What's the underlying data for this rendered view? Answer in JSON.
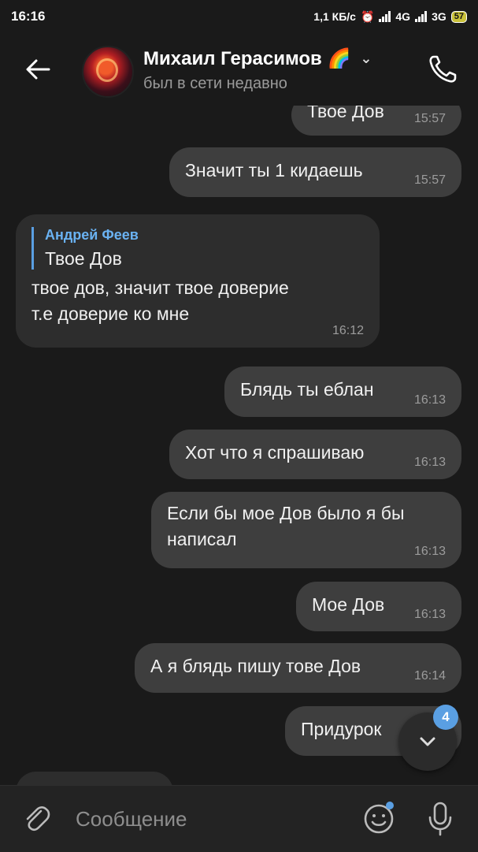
{
  "status_bar": {
    "time": "16:16",
    "speed": "1,1 КБ/с",
    "net1": "4G",
    "net2": "3G",
    "battery": "57"
  },
  "header": {
    "contact_name": "Михаил Герасимов 🌈",
    "last_seen": "был в сети недавно"
  },
  "messages": [
    {
      "text": "Твое Дов",
      "time": "15:57"
    },
    {
      "text": "Значит ты 1 кидаешь",
      "time": "15:57"
    },
    {
      "reply_name": "Андрей Феев",
      "reply_text": "Твое Дов",
      "text_line1": "твое дов, значит твое доверие",
      "text_line2": "т.е доверие ко мне",
      "time": "16:12"
    },
    {
      "text": "Блядь ты еблан",
      "time": "16:13"
    },
    {
      "text": "Хот что я спрашиваю",
      "time": "16:13"
    },
    {
      "text_line1": "Если бы мое Дов было я бы",
      "text_line2": "написал",
      "time": "16:13"
    },
    {
      "text": "Мое Дов",
      "time": "16:13"
    },
    {
      "text": "А я блядь пишу тове Дов",
      "time": "16:14"
    },
    {
      "text": "Придурок"
    }
  ],
  "scroll_badge": "4",
  "input": {
    "placeholder": "Сообщение"
  },
  "colors": {
    "accent": "#5a9fe2",
    "bubble": "#3e3e3e",
    "background": "#1a1a1a"
  }
}
